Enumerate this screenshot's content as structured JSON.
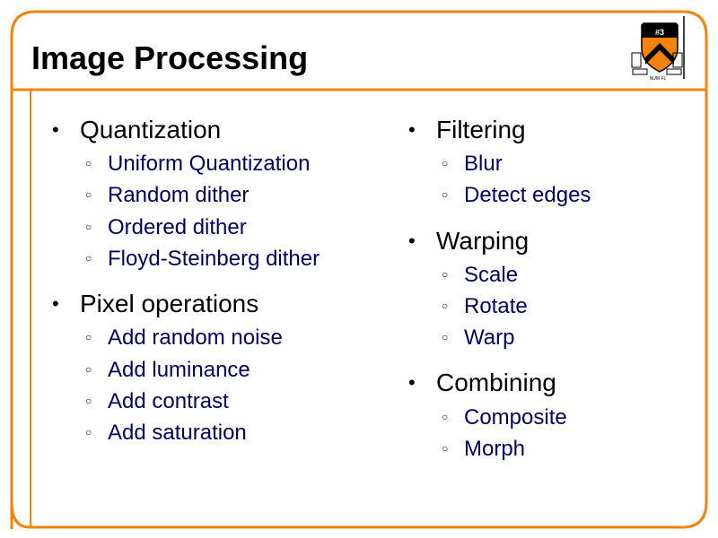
{
  "slide": {
    "title": "Image Processing",
    "logo_icon": "princeton-shield-logo-icon",
    "accent_color": "#F5820A",
    "heading_color": "#000000",
    "subitem_color": "#000066",
    "columns": [
      {
        "groups": [
          {
            "heading": "Quantization",
            "items": [
              "Uniform Quantization",
              "Random dither",
              "Ordered dither",
              "Floyd-Steinberg dither"
            ]
          },
          {
            "heading": "Pixel operations",
            "items": [
              "Add random noise",
              "Add luminance",
              "Add contrast",
              "Add saturation"
            ]
          }
        ]
      },
      {
        "groups": [
          {
            "heading": "Filtering",
            "items": [
              "Blur",
              "Detect edges"
            ]
          },
          {
            "heading": "Warping",
            "items": [
              "Scale",
              "Rotate",
              "Warp"
            ]
          },
          {
            "heading": "Combining",
            "items": [
              "Composite",
              "Morph"
            ]
          }
        ]
      }
    ]
  },
  "glyphs": {
    "bullet": "•",
    "sub_bullet": "○"
  }
}
